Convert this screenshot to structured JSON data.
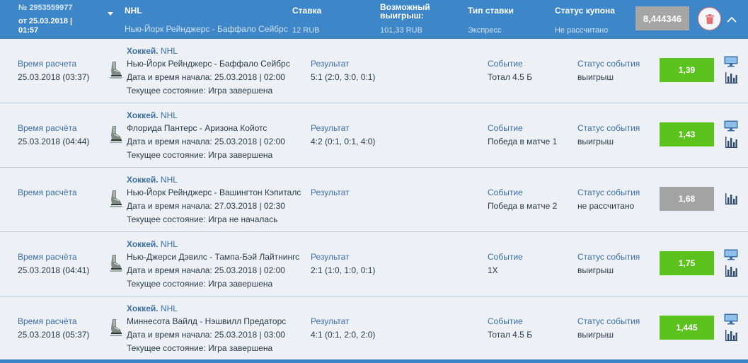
{
  "coupon": {
    "id": "№ 2953559977",
    "date": "от 25.03.2018 | 01:57",
    "league": "NHL",
    "match": "Нью-Йорк Рейнджерс - Баффало Сейбрс",
    "stake_label": "Ставка",
    "stake_value": "12 RUB",
    "win_label": "Возможный выигрыш:",
    "win_value": "101,33 RUB",
    "type_label": "Тип ставки",
    "type_value": "Экспресс",
    "status_label": "Статус купона",
    "status_value": "Не рассчитано",
    "total_odds": "8,444346"
  },
  "icons": {
    "delete": "trash-icon",
    "collapse": "chevron-up-icon",
    "expand": "caret-down-icon",
    "sport": "hockey-skate-icon",
    "live": "monitor-icon",
    "stats": "bar-chart-icon"
  },
  "colors": {
    "header": "#3d86c8",
    "win": "#5cc21e",
    "pending": "#a3a3a3",
    "label": "#3b6fa6",
    "delete": "#e57373"
  },
  "events": [
    {
      "calc_label": "Время расчета",
      "calc_value": "25.03.2018 (03:37)",
      "sport": "Хоккей.",
      "league": "NHL",
      "match": "Нью-Йорк Рейнджерс - Баффало Сейбрс",
      "start": "Дата и время начала: 25.03.2018 | 02:00",
      "state": "Текущее состояние: Игра завершена",
      "result_label": "Результат",
      "result_value": "5:1 (2:0, 3:0, 0:1)",
      "event_label": "Событие",
      "event_value": "Тотал 4.5 Б",
      "status_label": "Статус события",
      "status_value": "выигрыш",
      "odds": "1,39"
    },
    {
      "calc_label": "Время расчёта",
      "calc_value": "25.03.2018 (04:44)",
      "sport": "Хоккей.",
      "league": "NHL",
      "match": "Флорида Пантерс - Аризона Койотс",
      "start": "Дата и время начала: 25.03.2018 | 02:00",
      "state": "Текущее состояние: Игра завершена",
      "result_label": "Результат",
      "result_value": "4:2 (0:1, 0:1, 4:0)",
      "event_label": "Событие",
      "event_value": "Победа в матче 1",
      "status_label": "Статус события",
      "status_value": "выигрыш",
      "odds": "1,43"
    },
    {
      "calc_label": "Время расчёта",
      "calc_value": "",
      "sport": "Хоккей.",
      "league": "NHL",
      "match": "Нью-Йорк Рейнджерс - Вашингтон Кэпиталс",
      "start": "Дата и время начала: 27.03.2018 | 02:30",
      "state": "Текущее состояние: Игра не началась",
      "result_label": "Результат",
      "result_value": "",
      "event_label": "Событие",
      "event_value": "Победа в матче 2",
      "status_label": "Статус события",
      "status_value": "не рассчитано",
      "odds": "1,68"
    },
    {
      "calc_label": "Время расчёта",
      "calc_value": "25.03.2018 (04:41)",
      "sport": "Хоккей.",
      "league": "NHL",
      "match": "Нью-Джерси Дэвилс - Тампа-Бэй Лайтнингс",
      "start": "Дата и время начала: 25.03.2018 | 02:00",
      "state": "Текущее состояние: Игра завершена",
      "result_label": "Результат",
      "result_value": "2:1 (1:0, 1:0, 0:1)",
      "event_label": "Событие",
      "event_value": "1X",
      "status_label": "Статус события",
      "status_value": "выигрыш",
      "odds": "1,75"
    },
    {
      "calc_label": "Время расчёта",
      "calc_value": "25.03.2018 (05:37)",
      "sport": "Хоккей.",
      "league": "NHL",
      "match": "Миннесота Вайлд - Нэшвилл Предаторс",
      "start": "Дата и время начала: 25.03.2018 | 03:00",
      "state": "Текущее состояние: Игра завершена",
      "result_label": "Результат",
      "result_value": "4:1 (0:1, 2:0, 2:0)",
      "event_label": "Событие",
      "event_value": "Тотал 4.5 Б",
      "status_label": "Статус события",
      "status_value": "выигрыш",
      "odds": "1,445"
    }
  ]
}
